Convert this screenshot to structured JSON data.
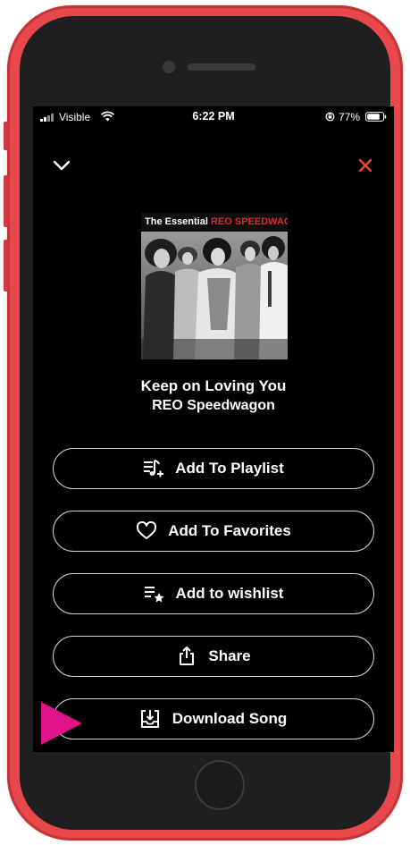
{
  "status_bar": {
    "carrier": "Visible",
    "time": "6:22 PM",
    "battery": "77%"
  },
  "header": {
    "collapse_icon": "chevron-down-icon",
    "close_icon": "close-icon",
    "close_color": "#e8472e"
  },
  "album": {
    "cover_prefix": "The Essential",
    "cover_band": "REO SPEEDWAGON",
    "cover_band_color": "#e0262b"
  },
  "track": {
    "title": "Keep on Loving You",
    "artist": "REO Speedwagon"
  },
  "actions": [
    {
      "label": "Add To Playlist",
      "icon": "playlist-add-icon"
    },
    {
      "label": "Add To Favorites",
      "icon": "heart-icon"
    },
    {
      "label": "Add to wishlist",
      "icon": "wishlist-star-icon"
    },
    {
      "label": "Share",
      "icon": "share-icon"
    },
    {
      "label": "Download Song",
      "icon": "download-icon"
    }
  ],
  "pointer_color": "#e0148a"
}
